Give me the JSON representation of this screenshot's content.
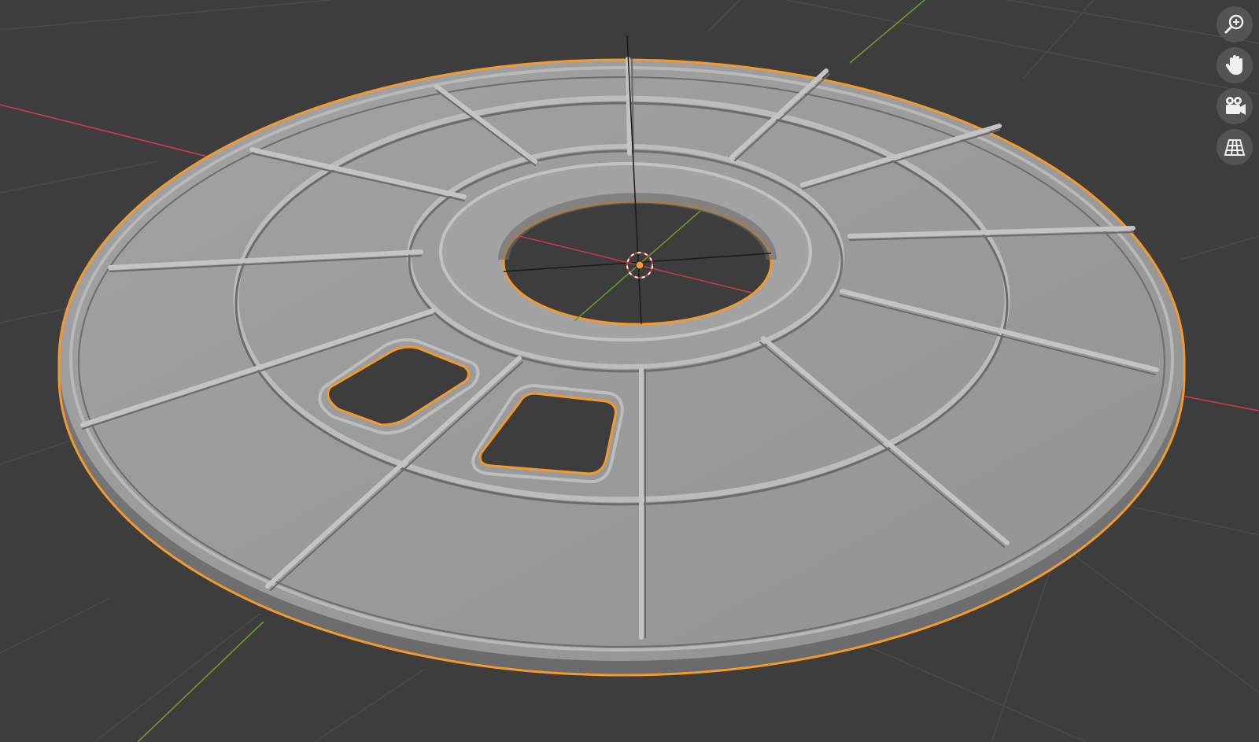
{
  "viewport": {
    "background": "#3d3d3d",
    "grid_color": "#4a4a4a",
    "x_axis_color": "#c8394d",
    "y_axis_color": "#6e9a2c",
    "selection_outline": "#f29a2e",
    "mesh_color": "#9b9b9b"
  },
  "object": {
    "name": "",
    "type": "ring-tray-mesh",
    "selected": true,
    "has_origin_marker": true
  },
  "gizmos": [
    {
      "id": "zoom",
      "icon": "zoom-in-icon"
    },
    {
      "id": "pan",
      "icon": "hand-icon"
    },
    {
      "id": "camera",
      "icon": "camera-icon"
    },
    {
      "id": "perspective",
      "icon": "grid-perspective-icon"
    }
  ]
}
